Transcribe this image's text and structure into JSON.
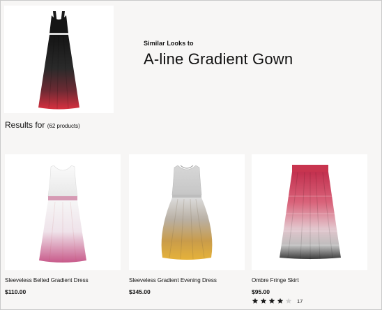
{
  "hero": {
    "similar_label": "Similar Looks to",
    "title": "A-line Gradient Gown",
    "image_icon": "gown-image"
  },
  "results": {
    "label": "Results for",
    "count": "(62 products)"
  },
  "products": [
    {
      "name": "Sleeveless Belted Gradient Dress",
      "price": "$110.00",
      "image_icon": "dress-image"
    },
    {
      "name": "Sleeveless Gradient Evening Dress",
      "price": "$345.00",
      "image_icon": "dress-image"
    },
    {
      "name": "Ombre Fringe Skirt",
      "price": "$95.00",
      "image_icon": "skirt-image",
      "rating": 4,
      "rating_max": 5,
      "rating_count": "17"
    }
  ],
  "colors": {
    "background": "#f7f6f5",
    "card": "#ffffff",
    "star_filled": "#1a1a1a",
    "star_empty": "#d0d0d0"
  }
}
